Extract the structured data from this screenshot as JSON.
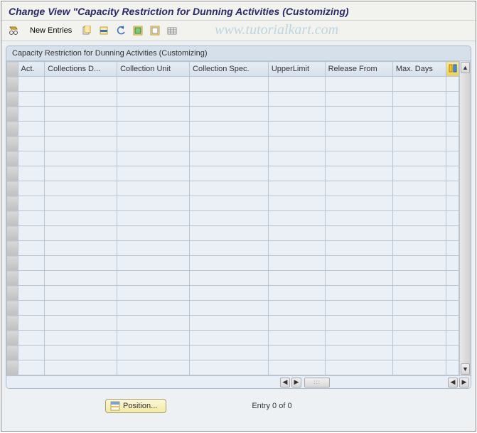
{
  "title": "Change View \"Capacity Restriction for Dunning Activities (Customizing)",
  "toolbar": {
    "new_entries": "New Entries"
  },
  "watermark": "www.tutorialkart.com",
  "panel": {
    "title": "Capacity Restriction for Dunning Activities (Customizing)",
    "columns": {
      "act": "Act.",
      "collections_d": "Collections D...",
      "collection_unit": "Collection Unit",
      "collection_spec": "Collection Spec.",
      "upper_limit": "UpperLimit",
      "release_from": "Release From",
      "max_days": "Max. Days"
    }
  },
  "footer": {
    "position": "Position...",
    "entry": "Entry 0 of 0"
  }
}
